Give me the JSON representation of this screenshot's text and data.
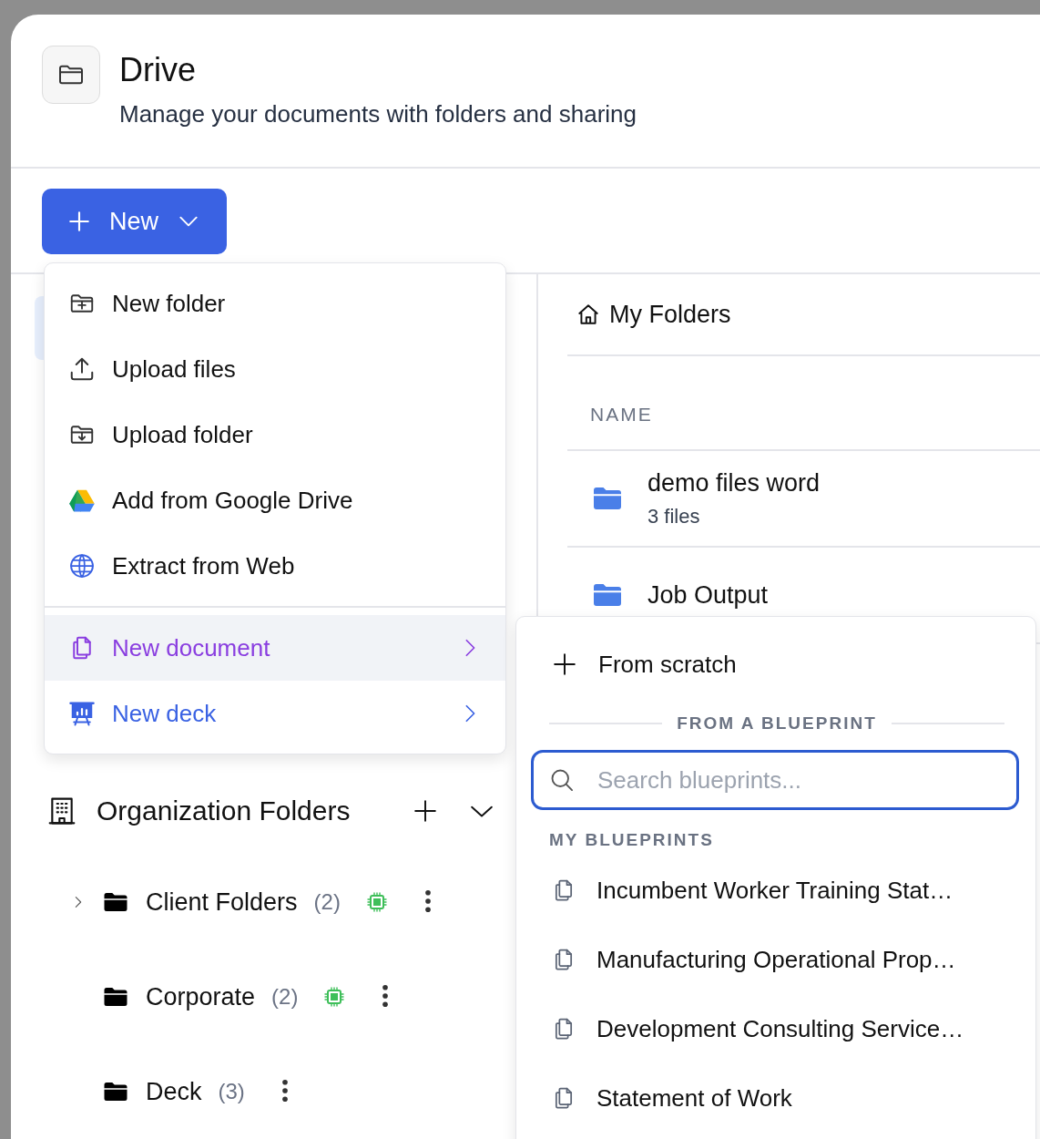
{
  "header": {
    "title": "Drive",
    "subtitle": "Manage your documents with folders and sharing"
  },
  "new_button": {
    "label": "New"
  },
  "sidebar": {
    "section": {
      "title": "Organization Folders",
      "expanded": true
    },
    "folders": [
      {
        "name": "Client Folders",
        "count": "(2)",
        "has_children": true,
        "status_badge": true
      },
      {
        "name": "Corporate",
        "count": "(2)",
        "has_children": false,
        "status_badge": true
      },
      {
        "name": "Deck",
        "count": "(3)",
        "has_children": false,
        "status_badge": false
      }
    ]
  },
  "content": {
    "title": "My Folders",
    "columns": [
      "NAME"
    ],
    "rows": [
      {
        "name": "demo files word",
        "meta": "3 files"
      },
      {
        "name": "Job Output"
      }
    ]
  },
  "new_menu": {
    "items": [
      {
        "label": "New folder",
        "kind": "action",
        "selected": false
      },
      {
        "label": "Upload files",
        "kind": "action",
        "selected": false
      },
      {
        "label": "Upload folder",
        "kind": "action",
        "selected": false
      },
      {
        "label": "Add from Google Drive",
        "kind": "action",
        "selected": false
      },
      {
        "label": "Extract from Web",
        "kind": "action",
        "selected": false
      },
      {
        "label": "New document",
        "kind": "submenu",
        "selected": true,
        "color": "#8a3ee0"
      },
      {
        "label": "New deck",
        "kind": "submenu",
        "selected": false,
        "color": "#3a62e3"
      }
    ]
  },
  "submenu": {
    "scratch": "From scratch",
    "divider_label": "FROM A BLUEPRINT",
    "search": {
      "placeholder": "Search blueprints...",
      "focused": true
    },
    "group_label": "MY BLUEPRINTS",
    "blueprints": [
      "Incumbent Worker Training Stat…",
      "Manufacturing Operational Prop…",
      "Development Consulting Service…",
      "Statement of Work"
    ]
  }
}
